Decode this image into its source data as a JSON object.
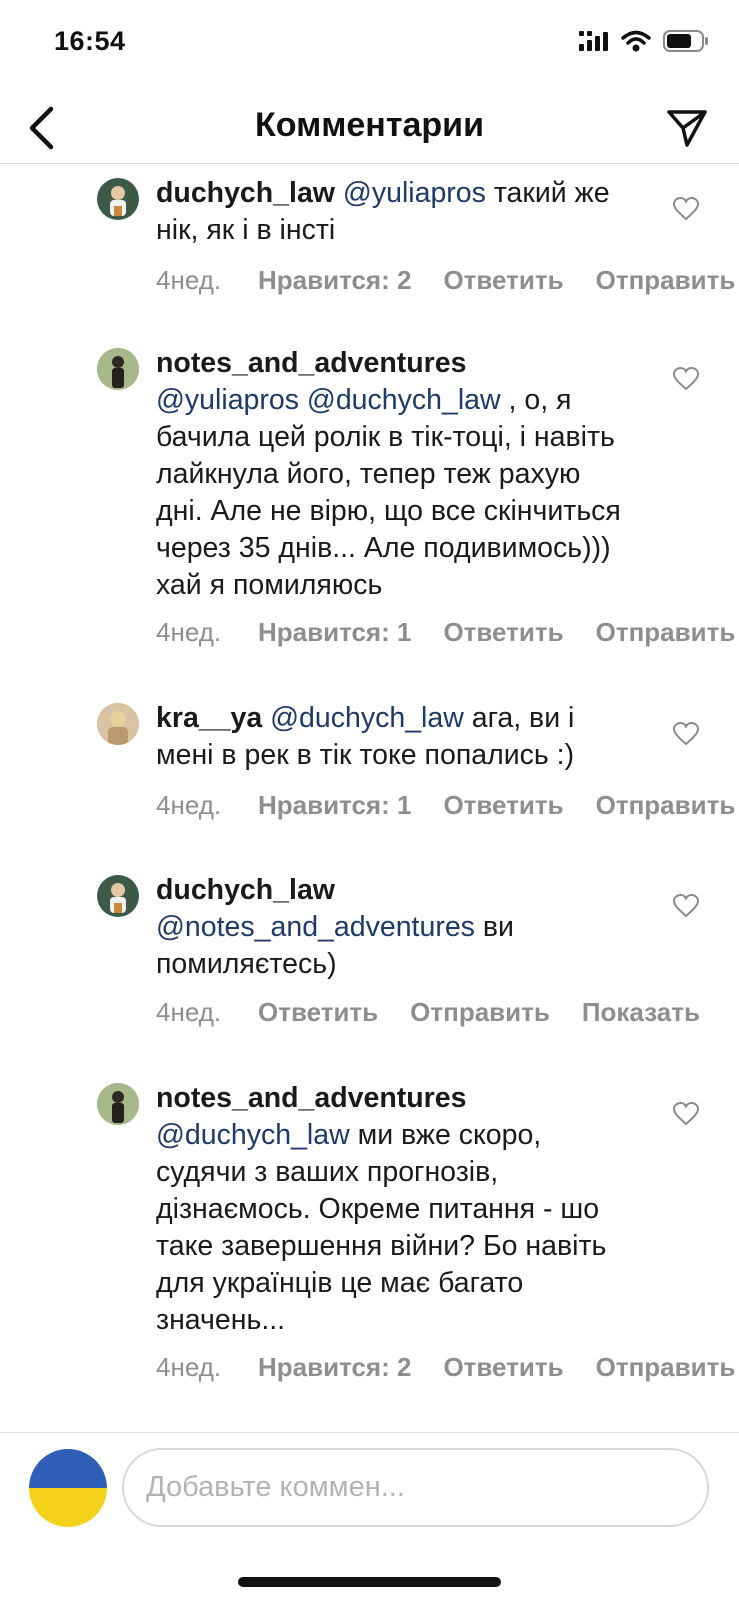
{
  "status_bar": {
    "time": "16:54",
    "icons": [
      "signal-icon",
      "wifi-icon",
      "battery-icon"
    ]
  },
  "header": {
    "title": "Комментарии",
    "back_icon": "chevron-left-icon",
    "send_icon": "paper-plane-icon"
  },
  "comments": [
    {
      "username": "duchych_law",
      "mention": "@yuliapros",
      "text": " такий же нік, як і в інсті",
      "time": "4нед.",
      "likes_label": "Нравится: 2",
      "reply_label": "Ответить",
      "send_label": "Отправить",
      "avatar_color": "#3d5a48"
    },
    {
      "username": "notes_and_adventures",
      "mention": "@yuliapros @duchych_law",
      "text": " , о, я бачила цей ролік в тік-тоці, і навіть лайкнула його, тепер теж рахую дні. Але не вірю, що все скінчиться через 35 днів... Але подивимось))) хай я помиляюсь",
      "time": "4нед.",
      "likes_label": "Нравится: 1",
      "reply_label": "Ответить",
      "send_label": "Отправить",
      "avatar_color": "#7c8f5a"
    },
    {
      "username": "kra__ya",
      "mention": "@duchych_law",
      "text": " ага, ви і мені в рек в тік токе попались :)",
      "time": "4нед.",
      "likes_label": "Нравится: 1",
      "reply_label": "Ответить",
      "send_label": "Отправить",
      "avatar_color": "#c9a77f"
    },
    {
      "username": "duchych_law",
      "mention": "@notes_and_adventures",
      "text": " ви помиляєтесь)",
      "time": "4нед.",
      "likes_label": "",
      "reply_label": "Ответить",
      "send_label": "Отправить",
      "extra_label": "Показать",
      "avatar_color": "#3d5a48"
    },
    {
      "username": "notes_and_adventures",
      "mention": "@duchych_law",
      "text": " ми вже скоро, судячи з ваших прогнозів, дізнаємось. Окреме питання - шо таке завершення війни? Бо навіть для українців це має багато значень...",
      "time": "4нед.",
      "likes_label": "Нравится: 2",
      "reply_label": "Ответить",
      "send_label": "Отправить",
      "avatar_color": "#7c8f5a"
    }
  ],
  "composer": {
    "placeholder": "Добавьте коммен...",
    "value": "",
    "avatar_colors": [
      "#2f5fb6",
      "#f4d21b"
    ]
  }
}
